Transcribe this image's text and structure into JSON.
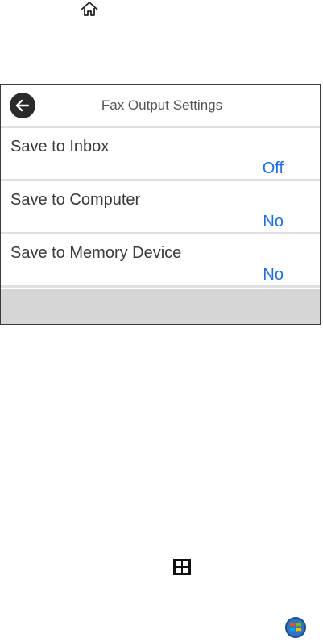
{
  "header": {
    "title": "Fax Output Settings"
  },
  "rows": [
    {
      "label": "Save to Inbox",
      "value": "Off"
    },
    {
      "label": "Save to Computer",
      "value": "No"
    },
    {
      "label": "Save to Memory Device",
      "value": "No"
    }
  ],
  "icons": {
    "home": "home-icon",
    "back": "back-arrow-icon",
    "start": "windows-start-icon",
    "win7": "windows-7-orb-icon"
  },
  "colors": {
    "value_text": "#1f6fe0",
    "back_button": "#2a2a2a",
    "footer": "#d6d6d6"
  }
}
